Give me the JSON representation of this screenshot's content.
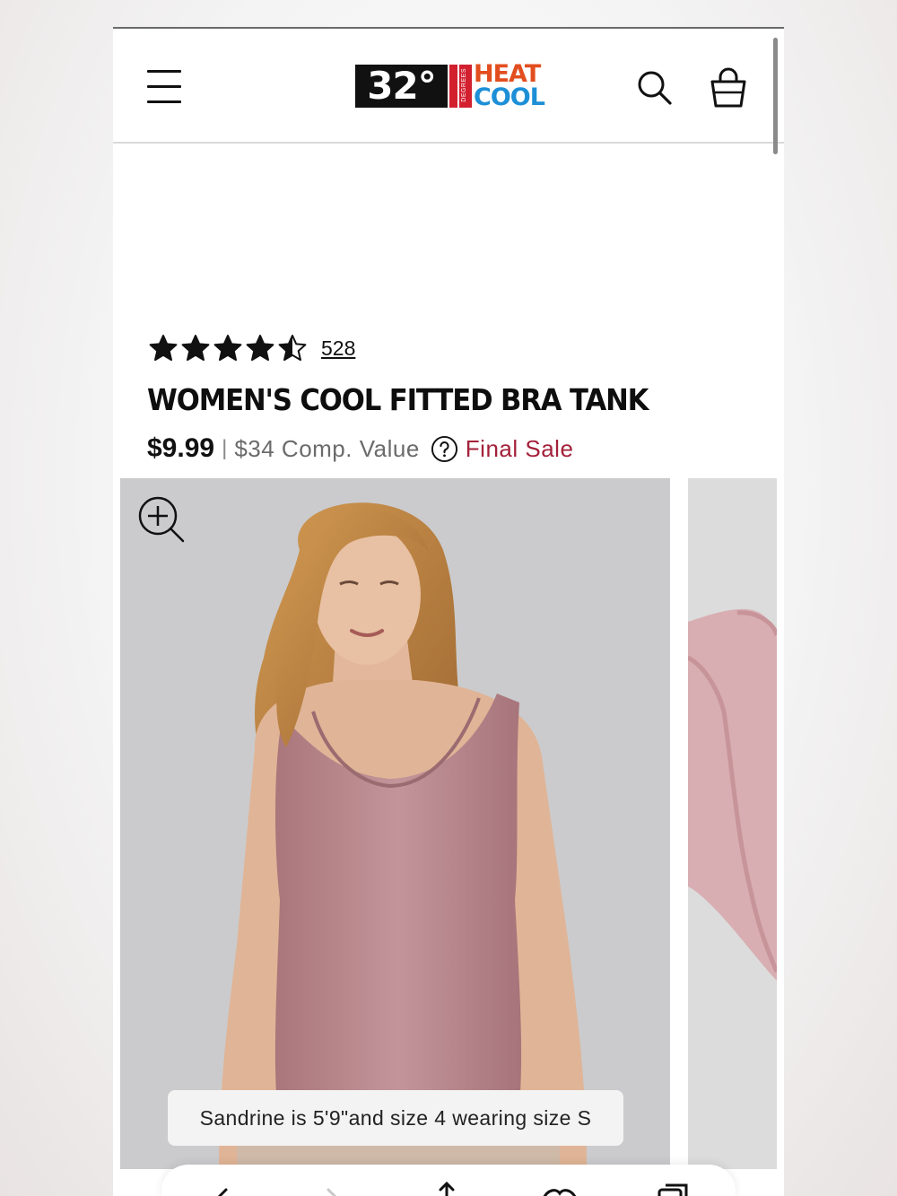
{
  "header": {
    "logo": {
      "number": "32°",
      "vertical_text": "DEGREES",
      "line1": "HEAT",
      "line2": "COOL"
    },
    "icons": [
      "menu-icon",
      "search-icon",
      "shopping-bag-icon"
    ]
  },
  "product": {
    "rating_stars": 4.5,
    "rating_max": 5,
    "review_count": "528",
    "title": "WOMEN'S COOL FITTED BRA TANK",
    "price": "$9.99",
    "separator": "|",
    "comp_value": "$34 Comp. Value",
    "final_sale": "Final Sale"
  },
  "gallery": {
    "caption": "Sandrine is 5'9\"and size 4 wearing size S"
  },
  "browser_bar": {
    "icons": [
      "back-icon",
      "forward-icon",
      "share-icon",
      "bookmarks-icon",
      "tabs-icon"
    ]
  },
  "colors": {
    "accent_final_sale": "#a3213a",
    "brand_red": "#d2202f",
    "brand_heat": "#e24e1f",
    "brand_cool": "#1d8fd6",
    "tank_pink": "#b9868a"
  }
}
